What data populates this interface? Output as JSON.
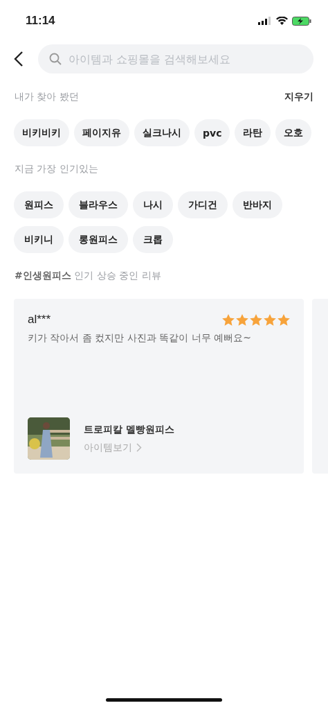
{
  "status_bar": {
    "time": "11:14"
  },
  "search": {
    "placeholder": "아이템과 쇼핑몰을 검색해보세요"
  },
  "recent": {
    "title": "내가 찾아 봤던",
    "clear": "지우기",
    "chips": [
      "비키비키",
      "페이지유",
      "실크나시",
      "pvc",
      "라탄",
      "오호"
    ]
  },
  "popular": {
    "title": "지금 가장 인기있는",
    "chips": [
      "원피스",
      "블라우스",
      "나시",
      "가디건",
      "반바지",
      "비키니",
      "롱원피스",
      "크롭"
    ]
  },
  "reviews": {
    "title": "**#인생원피스** 인기 상승 중인 리뷰",
    "cards": [
      {
        "user": "al***",
        "stars": 5,
        "text": "키가 작아서 좀 컸지만 사진과 똑같이 너무 예뻐요~",
        "item": "트로피칼 멜빵원피스",
        "link": "아이템보기"
      }
    ]
  }
}
